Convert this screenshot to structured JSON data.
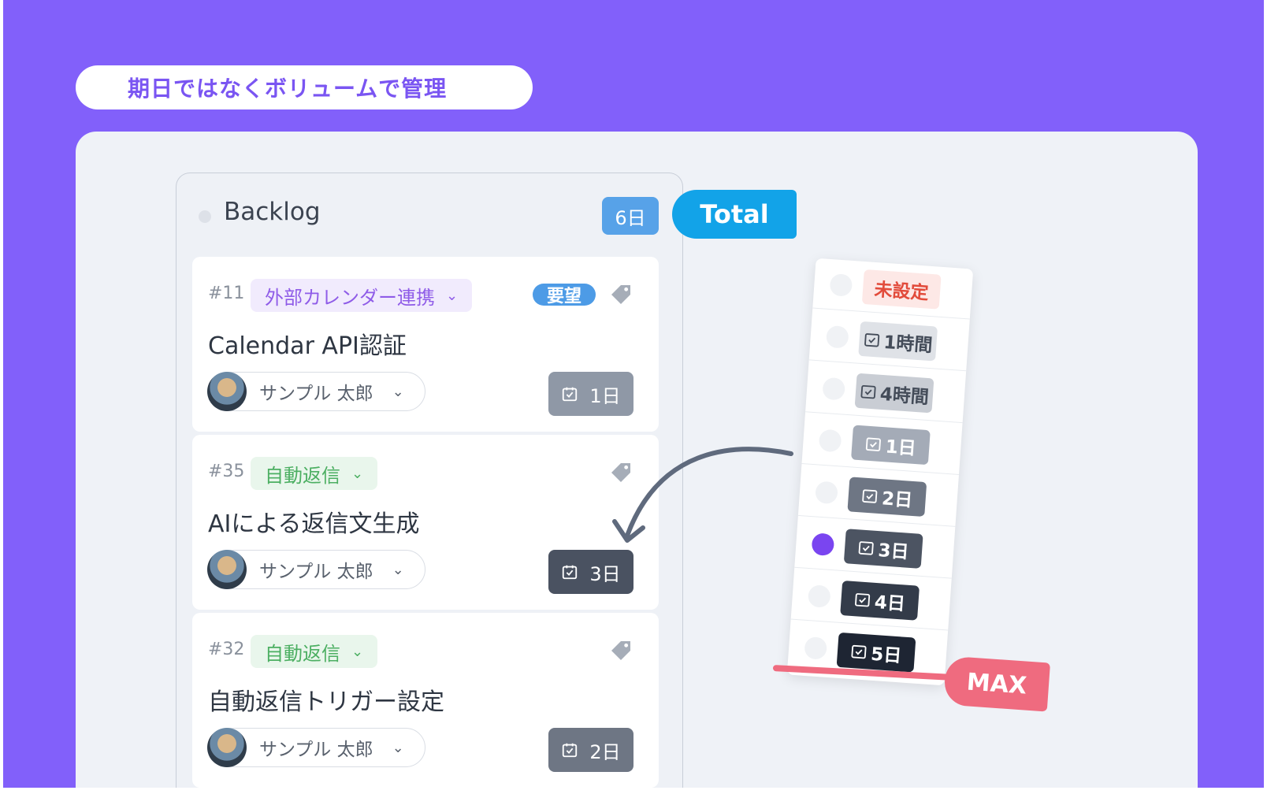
{
  "heading": "期日ではなくボリュームで管理",
  "column": {
    "title": "Backlog",
    "total": "6日",
    "total_tag": "Total"
  },
  "cards": [
    {
      "number": "#11",
      "category": "外部カレンダー連携",
      "request_badge": "要望",
      "title": "Calendar API認証",
      "assignee": "サンプル 太郎",
      "estimate": "1日"
    },
    {
      "number": "#35",
      "category": "自動返信",
      "title": "AIによる返信文生成",
      "assignee": "サンプル 太郎",
      "estimate": "3日"
    },
    {
      "number": "#32",
      "category": "自動返信",
      "title": "自動返信トリガー設定",
      "assignee": "サンプル 太郎",
      "estimate": "2日"
    }
  ],
  "estimate_menu": {
    "options": [
      "未設定",
      "1時間",
      "4時間",
      "1日",
      "2日",
      "3日",
      "4日",
      "5日"
    ],
    "selected": "3日"
  },
  "max_tag": "MAX",
  "colors": {
    "background": "#8260fa",
    "total_tag": "#12a3e8",
    "max_tag": "#ef6b7f",
    "selected_radio": "#7a45f0"
  }
}
